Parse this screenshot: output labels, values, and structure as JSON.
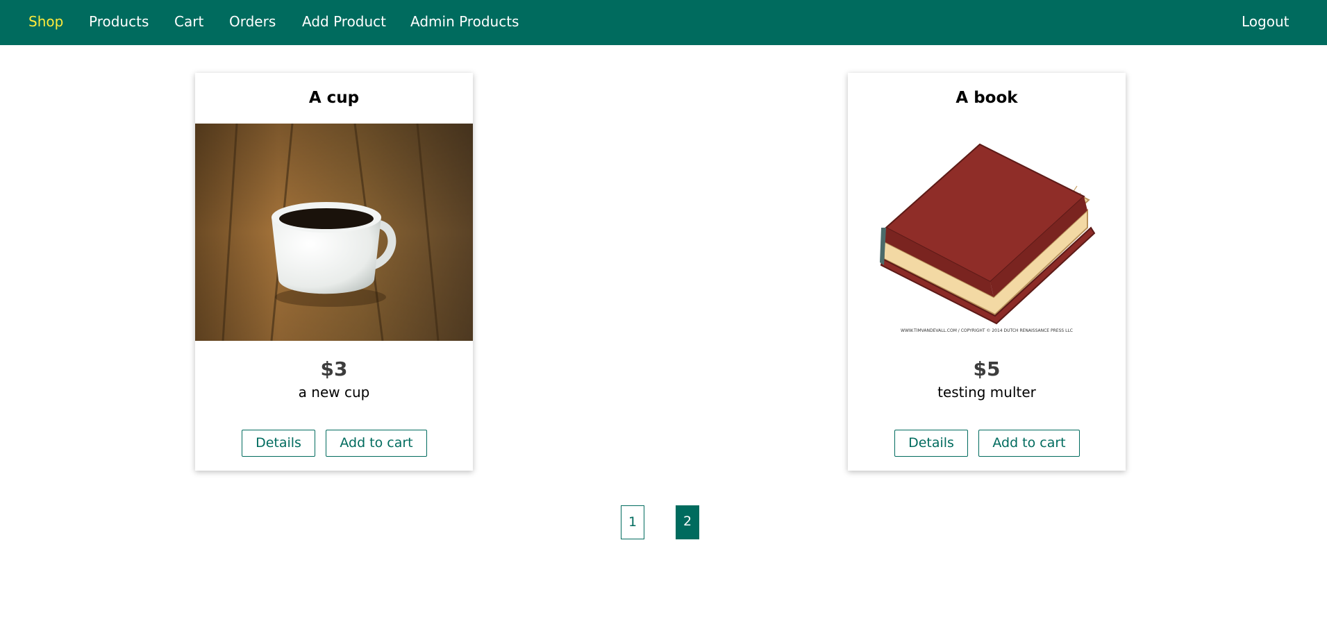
{
  "nav": {
    "links": [
      "Shop",
      "Products",
      "Cart",
      "Orders",
      "Add Product",
      "Admin Products"
    ],
    "active": "Shop",
    "logout": "Logout"
  },
  "products": [
    {
      "title": "A cup",
      "price": "$3",
      "description": "a new cup",
      "details_label": "Details",
      "add_to_cart_label": "Add to cart"
    },
    {
      "title": "A book",
      "price": "$5",
      "description": "testing multer",
      "image_caption": "WWW.TIMVANDEVALL.COM / COPYRIGHT © 2014 DUTCH RENAISSANCE PRESS LLC",
      "details_label": "Details",
      "add_to_cart_label": "Add to cart"
    }
  ],
  "pagination": {
    "pages": [
      "1",
      "2"
    ],
    "current": "2"
  },
  "colors": {
    "brand": "#006b5e",
    "active_nav": "#ffeb3b",
    "price": "#3d3d3d"
  }
}
